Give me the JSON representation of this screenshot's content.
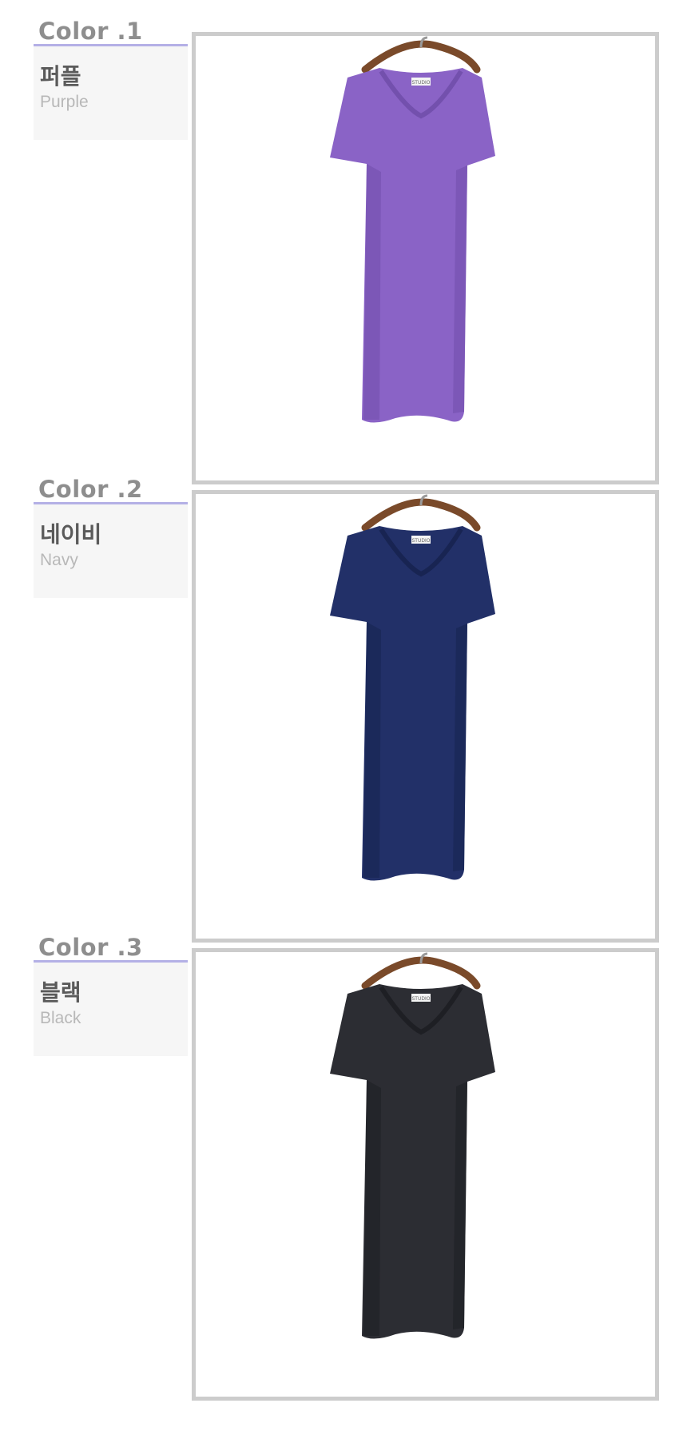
{
  "colors": [
    {
      "heading": "Color .1",
      "name_ko": "퍼플",
      "name_en": "Purple",
      "dress_color": "#8a63c6",
      "dress_shade": "#7350ad",
      "tag_text": "STUDIO"
    },
    {
      "heading": "Color .2",
      "name_ko": "네이비",
      "name_en": "Navy",
      "dress_color": "#223068",
      "dress_shade": "#182452",
      "tag_text": "STUDIO"
    },
    {
      "heading": "Color .3",
      "name_ko": "블랙",
      "name_en": "Black",
      "dress_color": "#2c2d33",
      "dress_shade": "#1e1f24",
      "tag_text": "STUDIO"
    }
  ],
  "accent_line_color": "#b4b0e6",
  "icons": [
    "hanger-icon"
  ]
}
